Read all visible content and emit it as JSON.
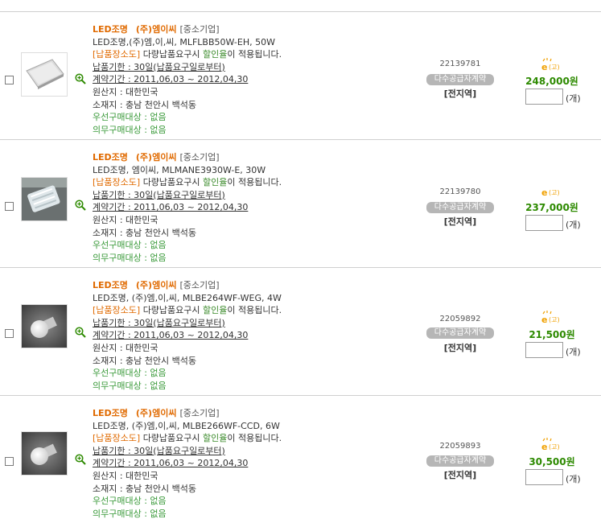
{
  "products": [
    {
      "category": "LED조명",
      "company": "(주)엠이씨",
      "tag": "[중소기업]",
      "name": "LED조명,(주)엠,이,씨, MLFLBB50W-EH, 50W",
      "place_label": "[납품장소도]",
      "disc_pre": "다량납품요구시",
      "disc_word": "할인율",
      "disc_post": "이 적용됩니다.",
      "deadline": "납품기한 : 30일(납품요구일로부터)",
      "contract": "계약기간 : 2011,06,03 ~ 2012,04,30",
      "origin": "원산지 : 대한민국",
      "location": "소재지 : 충남 천안시 백석동",
      "priority": "우선구매대상 : 없음",
      "mandatory": "의무구매대상 : 없음",
      "code": "22139781",
      "badge": "다수공급자계약",
      "region": "[전지역]",
      "price": "248,000원",
      "qty": "",
      "unit": "(개)",
      "icon": "panel-light"
    },
    {
      "category": "LED조명",
      "company": "(주)엠이씨",
      "tag": "[중소기업]",
      "name": "LED조명, 엠이씨, MLMANE3930W-E, 30W",
      "place_label": "[납품장소도]",
      "disc_pre": "다량납품요구시",
      "disc_word": "할인율",
      "disc_post": "이 적용됩니다.",
      "deadline": "납품기한 : 30일(납품요구일로부터)",
      "contract": "계약기간 : 2011,06,03 ~ 2012,04,30",
      "origin": "원산지 : 대한민국",
      "location": "소재지 : 충남 천안시 백석동",
      "priority": "우선구매대상 : 없음",
      "mandatory": "의무구매대상 : 없음",
      "code": "22139780",
      "badge": "다수공급자계약",
      "region": "[전지역]",
      "price": "237,000원",
      "qty": "",
      "unit": "(개)",
      "icon": "corn-bulb"
    },
    {
      "category": "LED조명",
      "company": "(주)엠이씨",
      "tag": "[중소기업]",
      "name": "LED조명, (주)엠,이,씨, MLBE264WF-WEG, 4W",
      "place_label": "[납품장소도]",
      "disc_pre": "다량납품요구시",
      "disc_word": "할인율",
      "disc_post": "이 적용됩니다.",
      "deadline": "납품기한 : 30일(납품요구일로부터)",
      "contract": "계약기간 : 2011,06,03 ~ 2012,04,30",
      "origin": "원산지 : 대한민국",
      "location": "소재지 : 충남 천안시 백석동",
      "priority": "우선구매대상 : 없음",
      "mandatory": "의무구매대상 : 없음",
      "code": "22059892",
      "badge": "다수공급자계약",
      "region": "[전지역]",
      "price": "21,500원",
      "qty": "",
      "unit": "(개)",
      "icon": "bulb"
    },
    {
      "category": "LED조명",
      "company": "(주)엠이씨",
      "tag": "[중소기업]",
      "name": "LED조명, (주)엠,이,씨, MLBE266WF-CCD, 6W",
      "place_label": "[납품장소도]",
      "disc_pre": "다량납품요구시",
      "disc_word": "할인율",
      "disc_post": "이 적용됩니다.",
      "deadline": "납품기한 : 30일(납품요구일로부터)",
      "contract": "계약기간 : 2011,06,03 ~ 2012,04,30",
      "origin": "원산지 : 대한민국",
      "location": "소재지 : 충남 천안시 백석동",
      "priority": "우선구매대상 : 없음",
      "mandatory": "의무구매대상 : 없음",
      "code": "22059893",
      "badge": "다수공급자계약",
      "region": "[전지역]",
      "price": "30,500원",
      "qty": "",
      "unit": "(개)",
      "icon": "bulb"
    }
  ],
  "eicon_label": "(고)",
  "colors": {
    "accent_orange": "#e06a00",
    "price_green": "#2d8a00",
    "info_green": "#3a9a3a"
  }
}
